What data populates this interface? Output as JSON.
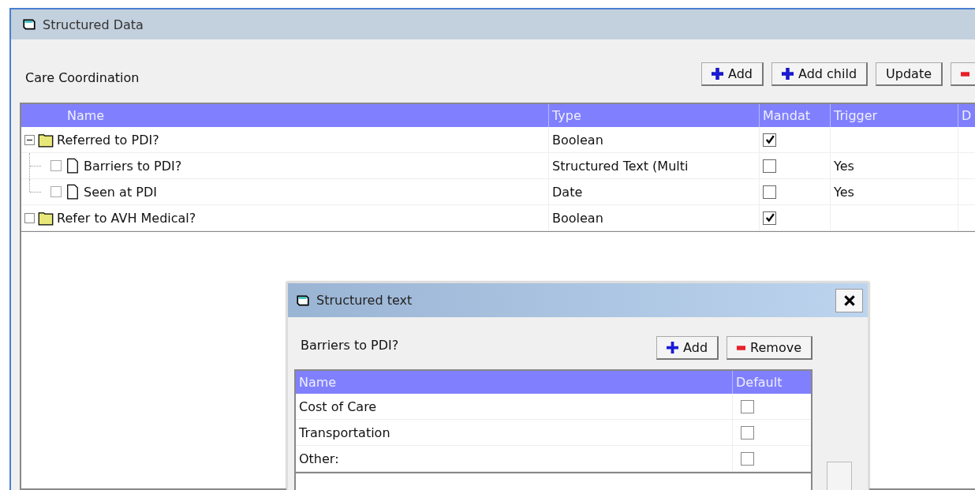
{
  "window": {
    "title": "Structured Data"
  },
  "section_title": "Care Coordination",
  "toolbar": [
    {
      "label": "Add",
      "kind": "add"
    },
    {
      "label": "Add child",
      "kind": "add"
    },
    {
      "label": "Update",
      "kind": "plain"
    },
    {
      "kind": "remove"
    }
  ],
  "table": {
    "columns": [
      "Name",
      "Type",
      "Mandat",
      "Trigger",
      "D"
    ],
    "rows": [
      {
        "name": "Referred to PDI?",
        "kind": "folder",
        "expanded": true,
        "type": "Boolean",
        "mandatory": true,
        "children": [
          {
            "name": "Barriers to PDI?",
            "kind": "document",
            "checked": false,
            "type": "Structured Text (Multi",
            "mandatory": false,
            "trigger": "Yes"
          },
          {
            "name": "Seen at PDI",
            "kind": "document",
            "checked": false,
            "type": "Date",
            "mandatory": false,
            "trigger": "Yes"
          }
        ]
      },
      {
        "name": "Refer to AVH Medical?",
        "kind": "folder",
        "expanded": false,
        "type": "Boolean",
        "mandatory": true
      }
    ]
  },
  "dialog": {
    "title": "Structured text",
    "label": "Barriers to PDI?",
    "buttons": [
      {
        "label": "Add",
        "kind": "add"
      },
      {
        "label": "Remove",
        "kind": "remove"
      }
    ],
    "columns": [
      "Name",
      "Default"
    ],
    "rows": [
      {
        "name": "Cost of Care",
        "default": false
      },
      {
        "name": "Transportation",
        "default": false
      },
      {
        "name": "Other:",
        "default": false
      }
    ]
  }
}
